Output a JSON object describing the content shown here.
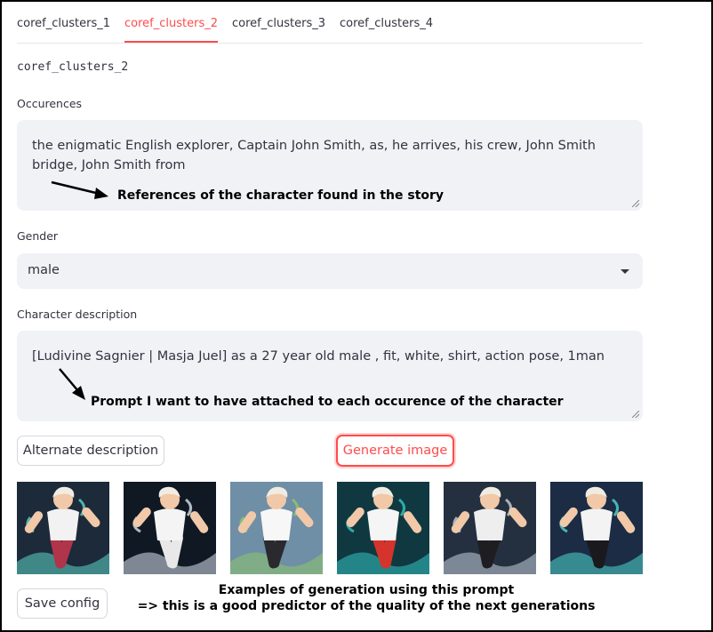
{
  "tabs": [
    {
      "label": "coref_clusters_1",
      "active": false
    },
    {
      "label": "coref_clusters_2",
      "active": true
    },
    {
      "label": "coref_clusters_3",
      "active": false
    },
    {
      "label": "coref_clusters_4",
      "active": false
    }
  ],
  "cluster_id": "coref_clusters_2",
  "occurences": {
    "label": "Occurences",
    "value": "the enigmatic English explorer, Captain John Smith, as, he arrives, his crew, John Smith bridge, John Smith from",
    "annotation": "References of the character found in the story"
  },
  "gender": {
    "label": "Gender",
    "value": "male"
  },
  "character_description": {
    "label": "Character description",
    "value": "[Ludivine Sagnier | Masja Juel] as a 27 year old male , fit, white, shirt, action pose,  1man",
    "annotation": "Prompt I want to have attached to each occurence of the character"
  },
  "buttons": {
    "alternate": "Alternate description",
    "generate": "Generate image",
    "save": "Save config"
  },
  "gallery": {
    "images": [
      {
        "name": "generated-image-1",
        "bg": "#1c2a3a",
        "shirt": "#f2f2f2",
        "pants": "#b0344a",
        "accent": "#5ed6c8"
      },
      {
        "name": "generated-image-2",
        "bg": "#101824",
        "shirt": "#f4f4f4",
        "pants": "#e8e8e8",
        "accent": "#d8e4ef"
      },
      {
        "name": "generated-image-3",
        "bg": "#6e8fa6",
        "shirt": "#f7f7f7",
        "pants": "#2a2a2e",
        "accent": "#8fc76a"
      },
      {
        "name": "generated-image-4",
        "bg": "#0f3840",
        "shirt": "#f5f5f5",
        "pants": "#d4342c",
        "accent": "#36c5c2"
      },
      {
        "name": "generated-image-5",
        "bg": "#243040",
        "shirt": "#eeeeee",
        "pants": "#1e1e22",
        "accent": "#c7d2dc"
      },
      {
        "name": "generated-image-6",
        "bg": "#1b2c44",
        "shirt": "#f3f3f3",
        "pants": "#1a1a1e",
        "accent": "#4fd8d0"
      }
    ],
    "caption_line1": "Examples of generation using this prompt",
    "caption_line2": "=> this is a good predictor of the quality of the next generations"
  },
  "colors": {
    "accent": "#ff4b4b",
    "input_bg": "#f0f2f6",
    "text": "#31333f"
  }
}
